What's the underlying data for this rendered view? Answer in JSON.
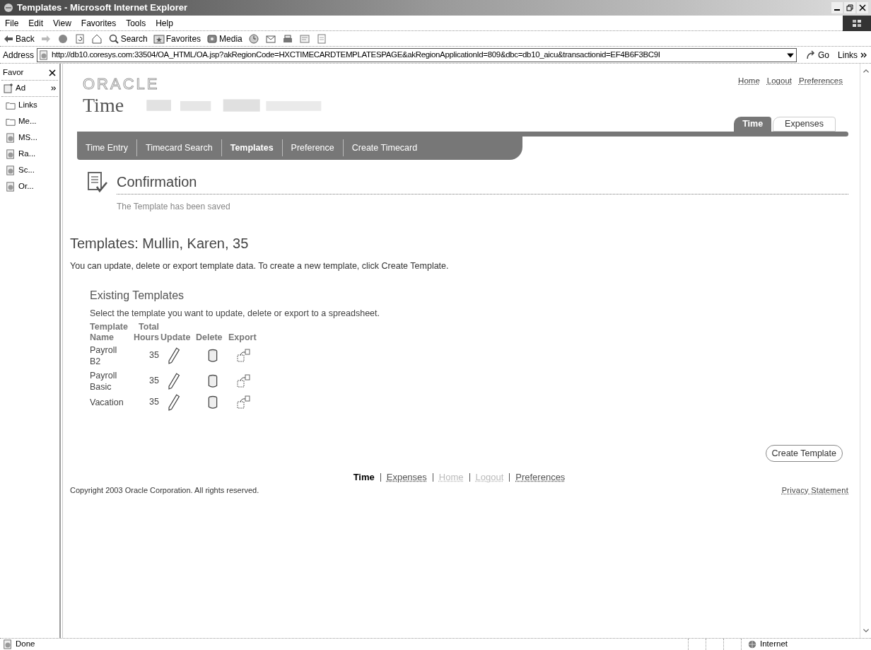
{
  "window": {
    "title": "Templates - Microsoft Internet Explorer"
  },
  "menu": [
    "File",
    "Edit",
    "View",
    "Favorites",
    "Tools",
    "Help"
  ],
  "toolbar": [
    {
      "kind": "back",
      "label": "Back"
    },
    {
      "kind": "search",
      "label": "Search"
    },
    {
      "kind": "favorites",
      "label": "Favorites"
    },
    {
      "kind": "media",
      "label": "Media"
    }
  ],
  "address": {
    "label": "Address",
    "value": "http://db10.coresys.com:33504/OA_HTML/OA.jsp?akRegionCode=HXCTIMECARDTEMPLATESPAGE&akRegionApplicationId=809&dbc=db10_aicu&transactionid=EF4B6F3BC9I",
    "go": "Go",
    "links": "Links"
  },
  "favorites": {
    "title": "Favor",
    "add": "Ad",
    "items": [
      {
        "kind": "folder",
        "label": "Links"
      },
      {
        "kind": "folder",
        "label": "Me..."
      },
      {
        "kind": "page",
        "label": "MS..."
      },
      {
        "kind": "page",
        "label": "Ra..."
      },
      {
        "kind": "page",
        "label": "Sc..."
      },
      {
        "kind": "page",
        "label": "Or..."
      }
    ]
  },
  "page": {
    "brand": "ORACLE",
    "product": "Time",
    "global_links": [
      "Home",
      "Logout",
      "Preferences"
    ],
    "tabs": [
      {
        "label": "Time",
        "selected": true
      },
      {
        "label": "Expenses",
        "selected": false
      }
    ],
    "subtabs": [
      {
        "label": "Time Entry",
        "selected": false
      },
      {
        "label": "Timecard Search",
        "selected": false
      },
      {
        "label": "Templates",
        "selected": true
      },
      {
        "label": "Preference",
        "selected": false
      },
      {
        "label": "Create Timecard",
        "selected": false
      }
    ],
    "confirmation": {
      "title": "Confirmation",
      "message": "The Template has been saved"
    },
    "heading": "Templates: Mullin, Karen, 35",
    "intro": "You can update, delete or export template data. To create a new template, click Create Template.",
    "section": {
      "title": "Existing Templates",
      "description": "Select the template you want to update, delete or export to a spreadsheet.",
      "columns": [
        "Template Name",
        "Total Hours",
        "Update",
        "Delete",
        "Export"
      ],
      "rows": [
        {
          "name": "Payroll B2",
          "hours": "35"
        },
        {
          "name": "Payroll Basic",
          "hours": "35"
        },
        {
          "name": "Vacation",
          "hours": "35"
        }
      ]
    },
    "create_button": "Create Template",
    "footer_links": [
      {
        "label": "Time",
        "kind": "current"
      },
      {
        "label": "Expenses",
        "kind": "link"
      },
      {
        "label": "Home",
        "kind": "disabled"
      },
      {
        "label": "Logout",
        "kind": "disabled"
      },
      {
        "label": "Preferences",
        "kind": "link"
      }
    ],
    "copyright": "Copyright 2003 Oracle Corporation. All rights reserved.",
    "privacy": "Privacy Statement"
  },
  "status": {
    "text": "Done",
    "zone": "Internet"
  }
}
